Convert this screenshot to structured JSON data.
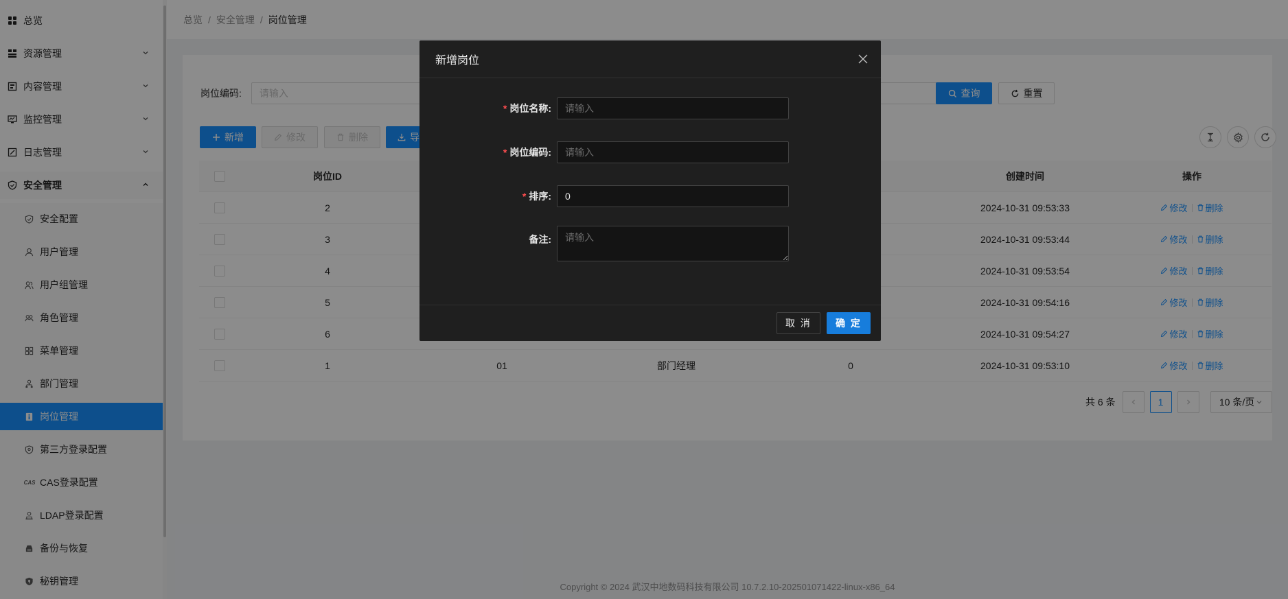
{
  "sidebar": {
    "items": [
      {
        "label": "总览",
        "icon": "dashboard-icon"
      },
      {
        "label": "资源管理",
        "icon": "resource-icon",
        "expandable": true
      },
      {
        "label": "内容管理",
        "icon": "content-icon",
        "expandable": true
      },
      {
        "label": "监控管理",
        "icon": "monitor-icon",
        "expandable": true
      },
      {
        "label": "日志管理",
        "icon": "log-icon",
        "expandable": true
      },
      {
        "label": "安全管理",
        "icon": "shield-icon",
        "expandable": true,
        "expanded": true
      }
    ],
    "sub_items": [
      {
        "label": "安全配置",
        "icon": "shield-check-icon"
      },
      {
        "label": "用户管理",
        "icon": "user-icon"
      },
      {
        "label": "用户组管理",
        "icon": "user-group-icon"
      },
      {
        "label": "角色管理",
        "icon": "role-icon"
      },
      {
        "label": "菜单管理",
        "icon": "menu-icon"
      },
      {
        "label": "部门管理",
        "icon": "department-icon"
      },
      {
        "label": "岗位管理",
        "icon": "post-icon",
        "selected": true
      },
      {
        "label": "第三方登录配置",
        "icon": "third-party-icon"
      },
      {
        "label": "CAS登录配置",
        "icon": "cas-icon"
      },
      {
        "label": "LDAP登录配置",
        "icon": "ldap-icon"
      },
      {
        "label": "备份与恢复",
        "icon": "backup-icon"
      },
      {
        "label": "秘钥管理",
        "icon": "key-icon"
      }
    ],
    "cas_badge": "CAS"
  },
  "breadcrumb": {
    "items": [
      "总览",
      "安全管理",
      "岗位管理"
    ],
    "separator": "/"
  },
  "filter": {
    "label": "岗位编码:",
    "placeholder": "请输入",
    "search_label": "查询",
    "reset_label": "重置"
  },
  "toolbar": {
    "add_label": "新增",
    "edit_label": "修改",
    "delete_label": "删除",
    "export_label": "导"
  },
  "table": {
    "columns": [
      "岗位ID",
      "",
      "",
      "",
      "创建时间",
      "操作"
    ],
    "rows": [
      {
        "id": "2",
        "code": "",
        "name": "",
        "sort": "",
        "time": "2024-10-31 09:53:33"
      },
      {
        "id": "3",
        "code": "",
        "name": "",
        "sort": "",
        "time": "2024-10-31 09:53:44"
      },
      {
        "id": "4",
        "code": "",
        "name": "",
        "sort": "",
        "time": "2024-10-31 09:53:54"
      },
      {
        "id": "5",
        "code": "",
        "name": "",
        "sort": "",
        "time": "2024-10-31 09:54:16"
      },
      {
        "id": "6",
        "code": "",
        "name": "",
        "sort": "",
        "time": "2024-10-31 09:54:27"
      },
      {
        "id": "1",
        "code": "01",
        "name": "部门经理",
        "sort": "0",
        "time": "2024-10-31 09:53:10"
      }
    ],
    "edit_op": "修改",
    "delete_op": "删除"
  },
  "pagination": {
    "total": "共 6 条",
    "current": "1",
    "page_size": "10 条/页"
  },
  "footer": {
    "text": "Copyright © 2024 武汉中地数码科技有限公司 10.7.2.10-202501071422-linux-x86_64"
  },
  "modal": {
    "title": "新增岗位",
    "fields": {
      "name": {
        "label": "岗位名称:",
        "placeholder": "请输入",
        "required": true
      },
      "code": {
        "label": "岗位编码:",
        "placeholder": "请输入",
        "required": true
      },
      "sort": {
        "label": "排序:",
        "value": "0",
        "required": true
      },
      "remark": {
        "label": "备注:",
        "placeholder": "请输入",
        "required": false
      }
    },
    "required_mark": "*",
    "cancel_label": "取 消",
    "ok_label": "确 定"
  },
  "colors": {
    "primary": "#1890ff",
    "danger": "#ff4d4f",
    "modal_bg": "#1f1f1f",
    "mask": "rgba(0,0,0,0.45)"
  }
}
